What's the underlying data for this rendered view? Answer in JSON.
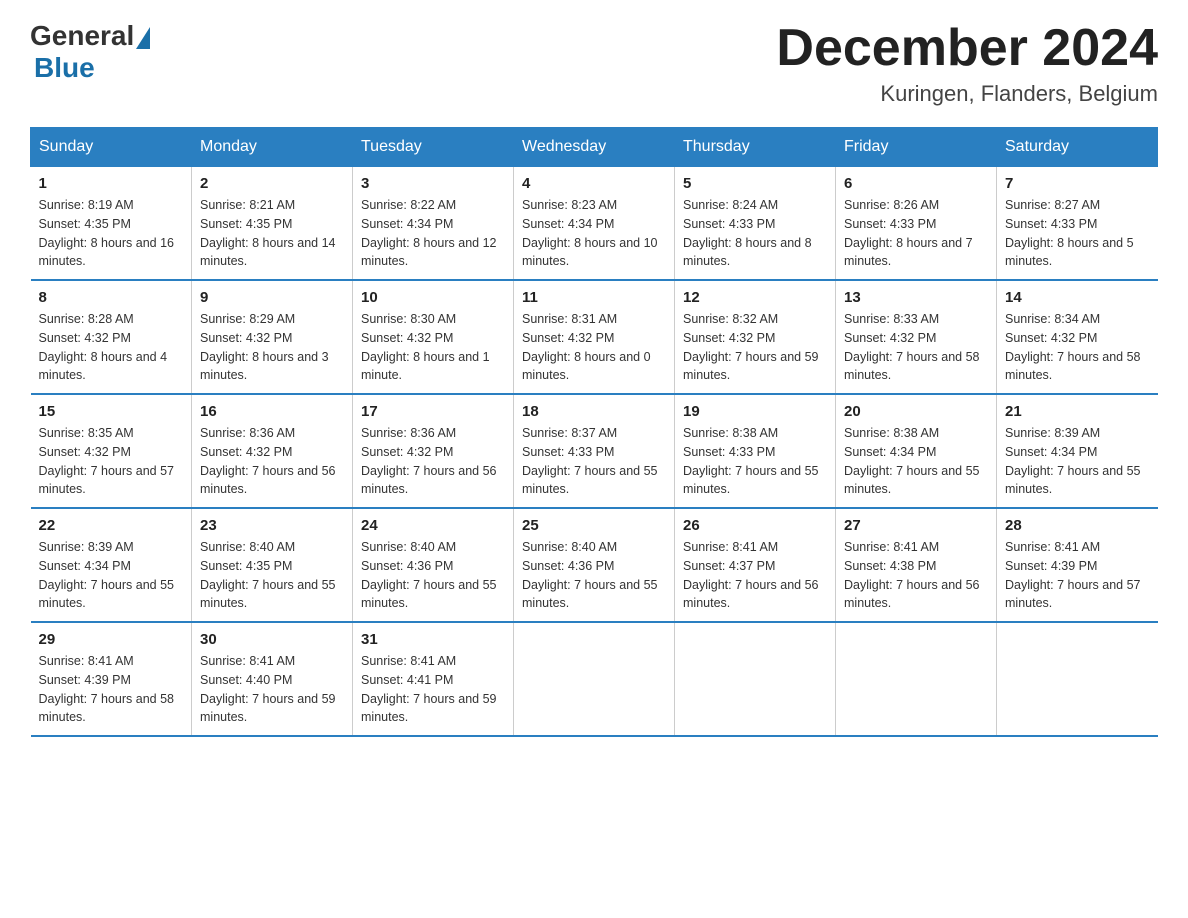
{
  "header": {
    "logo_general": "General",
    "logo_blue": "Blue",
    "month_title": "December 2024",
    "location": "Kuringen, Flanders, Belgium"
  },
  "weekdays": [
    "Sunday",
    "Monday",
    "Tuesday",
    "Wednesday",
    "Thursday",
    "Friday",
    "Saturday"
  ],
  "weeks": [
    [
      {
        "day": "1",
        "sunrise": "8:19 AM",
        "sunset": "4:35 PM",
        "daylight": "8 hours and 16 minutes."
      },
      {
        "day": "2",
        "sunrise": "8:21 AM",
        "sunset": "4:35 PM",
        "daylight": "8 hours and 14 minutes."
      },
      {
        "day": "3",
        "sunrise": "8:22 AM",
        "sunset": "4:34 PM",
        "daylight": "8 hours and 12 minutes."
      },
      {
        "day": "4",
        "sunrise": "8:23 AM",
        "sunset": "4:34 PM",
        "daylight": "8 hours and 10 minutes."
      },
      {
        "day": "5",
        "sunrise": "8:24 AM",
        "sunset": "4:33 PM",
        "daylight": "8 hours and 8 minutes."
      },
      {
        "day": "6",
        "sunrise": "8:26 AM",
        "sunset": "4:33 PM",
        "daylight": "8 hours and 7 minutes."
      },
      {
        "day": "7",
        "sunrise": "8:27 AM",
        "sunset": "4:33 PM",
        "daylight": "8 hours and 5 minutes."
      }
    ],
    [
      {
        "day": "8",
        "sunrise": "8:28 AM",
        "sunset": "4:32 PM",
        "daylight": "8 hours and 4 minutes."
      },
      {
        "day": "9",
        "sunrise": "8:29 AM",
        "sunset": "4:32 PM",
        "daylight": "8 hours and 3 minutes."
      },
      {
        "day": "10",
        "sunrise": "8:30 AM",
        "sunset": "4:32 PM",
        "daylight": "8 hours and 1 minute."
      },
      {
        "day": "11",
        "sunrise": "8:31 AM",
        "sunset": "4:32 PM",
        "daylight": "8 hours and 0 minutes."
      },
      {
        "day": "12",
        "sunrise": "8:32 AM",
        "sunset": "4:32 PM",
        "daylight": "7 hours and 59 minutes."
      },
      {
        "day": "13",
        "sunrise": "8:33 AM",
        "sunset": "4:32 PM",
        "daylight": "7 hours and 58 minutes."
      },
      {
        "day": "14",
        "sunrise": "8:34 AM",
        "sunset": "4:32 PM",
        "daylight": "7 hours and 58 minutes."
      }
    ],
    [
      {
        "day": "15",
        "sunrise": "8:35 AM",
        "sunset": "4:32 PM",
        "daylight": "7 hours and 57 minutes."
      },
      {
        "day": "16",
        "sunrise": "8:36 AM",
        "sunset": "4:32 PM",
        "daylight": "7 hours and 56 minutes."
      },
      {
        "day": "17",
        "sunrise": "8:36 AM",
        "sunset": "4:32 PM",
        "daylight": "7 hours and 56 minutes."
      },
      {
        "day": "18",
        "sunrise": "8:37 AM",
        "sunset": "4:33 PM",
        "daylight": "7 hours and 55 minutes."
      },
      {
        "day": "19",
        "sunrise": "8:38 AM",
        "sunset": "4:33 PM",
        "daylight": "7 hours and 55 minutes."
      },
      {
        "day": "20",
        "sunrise": "8:38 AM",
        "sunset": "4:34 PM",
        "daylight": "7 hours and 55 minutes."
      },
      {
        "day": "21",
        "sunrise": "8:39 AM",
        "sunset": "4:34 PM",
        "daylight": "7 hours and 55 minutes."
      }
    ],
    [
      {
        "day": "22",
        "sunrise": "8:39 AM",
        "sunset": "4:34 PM",
        "daylight": "7 hours and 55 minutes."
      },
      {
        "day": "23",
        "sunrise": "8:40 AM",
        "sunset": "4:35 PM",
        "daylight": "7 hours and 55 minutes."
      },
      {
        "day": "24",
        "sunrise": "8:40 AM",
        "sunset": "4:36 PM",
        "daylight": "7 hours and 55 minutes."
      },
      {
        "day": "25",
        "sunrise": "8:40 AM",
        "sunset": "4:36 PM",
        "daylight": "7 hours and 55 minutes."
      },
      {
        "day": "26",
        "sunrise": "8:41 AM",
        "sunset": "4:37 PM",
        "daylight": "7 hours and 56 minutes."
      },
      {
        "day": "27",
        "sunrise": "8:41 AM",
        "sunset": "4:38 PM",
        "daylight": "7 hours and 56 minutes."
      },
      {
        "day": "28",
        "sunrise": "8:41 AM",
        "sunset": "4:39 PM",
        "daylight": "7 hours and 57 minutes."
      }
    ],
    [
      {
        "day": "29",
        "sunrise": "8:41 AM",
        "sunset": "4:39 PM",
        "daylight": "7 hours and 58 minutes."
      },
      {
        "day": "30",
        "sunrise": "8:41 AM",
        "sunset": "4:40 PM",
        "daylight": "7 hours and 59 minutes."
      },
      {
        "day": "31",
        "sunrise": "8:41 AM",
        "sunset": "4:41 PM",
        "daylight": "7 hours and 59 minutes."
      },
      null,
      null,
      null,
      null
    ]
  ],
  "labels": {
    "sunrise": "Sunrise:",
    "sunset": "Sunset:",
    "daylight": "Daylight:"
  }
}
